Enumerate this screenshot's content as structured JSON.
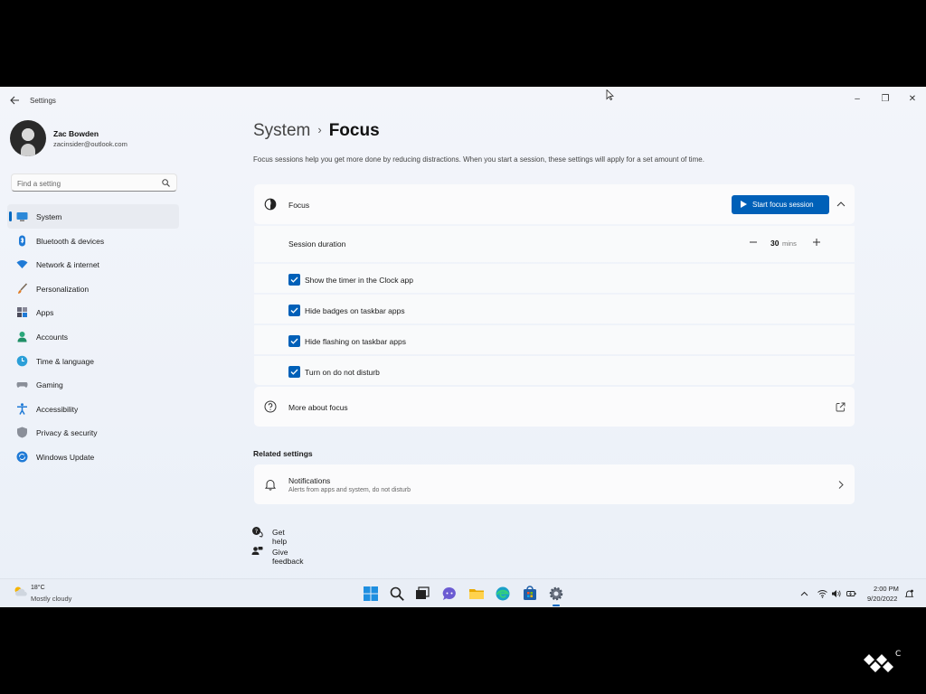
{
  "window": {
    "app_title": "Settings",
    "controls": {
      "minimize": "–",
      "restore": "❐",
      "close": "✕"
    }
  },
  "profile": {
    "name": "Zac Bowden",
    "email": "zacinsider@outlook.com"
  },
  "search": {
    "placeholder": "Find a setting",
    "value": ""
  },
  "sidebar": {
    "items": [
      {
        "label": "System",
        "icon": "system-icon",
        "active": true
      },
      {
        "label": "Bluetooth & devices",
        "icon": "bluetooth-icon"
      },
      {
        "label": "Network & internet",
        "icon": "wifi-icon"
      },
      {
        "label": "Personalization",
        "icon": "brush-icon"
      },
      {
        "label": "Apps",
        "icon": "apps-icon"
      },
      {
        "label": "Accounts",
        "icon": "person-icon"
      },
      {
        "label": "Time & language",
        "icon": "globe-clock-icon"
      },
      {
        "label": "Gaming",
        "icon": "controller-icon"
      },
      {
        "label": "Accessibility",
        "icon": "accessibility-icon"
      },
      {
        "label": "Privacy & security",
        "icon": "shield-icon"
      },
      {
        "label": "Windows Update",
        "icon": "update-icon"
      }
    ]
  },
  "main": {
    "breadcrumb": {
      "parent": "System",
      "separator": "›",
      "current": "Focus"
    },
    "description": "Focus sessions help you get more done by reducing distractions. When you start a session, these settings will apply for a set amount of time.",
    "focus_card": {
      "title": "Focus",
      "start_button": "Start focus session",
      "session_duration": {
        "label": "Session duration",
        "value": "30",
        "unit": "mins",
        "minus": "−",
        "plus": "+"
      },
      "options": [
        {
          "label": "Show the timer in the Clock app",
          "checked": true
        },
        {
          "label": "Hide badges on taskbar apps",
          "checked": true
        },
        {
          "label": "Hide flashing on taskbar apps",
          "checked": true
        },
        {
          "label": "Turn on do not disturb",
          "checked": true
        }
      ]
    },
    "more_about": {
      "label": "More about focus"
    },
    "related": {
      "heading": "Related settings",
      "notifications": {
        "title": "Notifications",
        "subtitle": "Alerts from apps and system, do not disturb"
      }
    },
    "links": {
      "get_help": "Get help",
      "give_feedback": "Give feedback"
    }
  },
  "taskbar": {
    "weather": {
      "temp": "18°C",
      "condition": "Mostly cloudy"
    },
    "clock": {
      "time": "2:00 PM",
      "date": "9/20/2022"
    },
    "pinned": [
      "windows-start-icon",
      "search-icon",
      "task-view-icon",
      "chat-icon",
      "file-explorer-icon",
      "edge-icon",
      "store-icon",
      "settings-gear-icon"
    ]
  },
  "colors": {
    "accent": "#0060b8",
    "window_bg": "#f3f5fa",
    "card_bg": "#fbfbfc"
  }
}
